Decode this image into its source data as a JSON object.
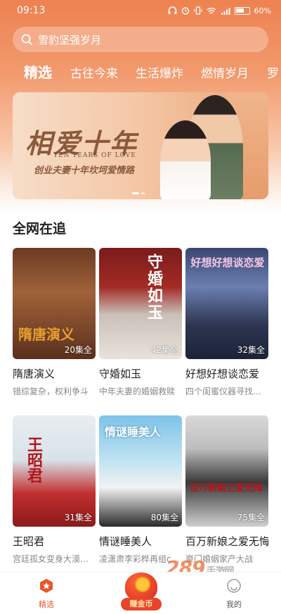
{
  "status_bar": {
    "time": "09:13",
    "battery": "60%"
  },
  "search": {
    "placeholder": "雪豹坚强岁月"
  },
  "tabs": [
    {
      "label": "精选",
      "active": true
    },
    {
      "label": "古往今来"
    },
    {
      "label": "生活爆炸"
    },
    {
      "label": "燃情岁月"
    },
    {
      "label": "罗"
    }
  ],
  "banner": {
    "title": "相爱十年",
    "subtitle_en": "TEN YEARS OF LOVE",
    "subtitle": "创业夫妻十年坎坷爱情路"
  },
  "section": {
    "title": "全网在追"
  },
  "cards": [
    {
      "name": "隋唐演义",
      "desc": "错综复杂，权利争斗",
      "episodes": "20集全",
      "poster_title": "隋唐演义"
    },
    {
      "name": "守婚如玉",
      "desc": "中年夫妻的婚姻救赎",
      "episodes": "42集全",
      "poster_title": "守婚如玉"
    },
    {
      "name": "好想好想谈恋爱",
      "desc": "四个闺蜜仪器寻找…",
      "episodes": "32集全",
      "poster_title": "好想好想谈恋爱"
    },
    {
      "name": "王昭君",
      "desc": "宫廷孤女变身大漠…",
      "episodes": "31集全",
      "poster_title": "王昭君"
    },
    {
      "name": "情谜睡美人",
      "desc": "凌潇肃李彩桦再组c…",
      "episodes": "80集全",
      "poster_title": "情谜睡美人"
    },
    {
      "name": "百万新娘之爱无悔",
      "desc": "豪门婚姻家产大战",
      "episodes": "75集全",
      "poster_title": "百万新娘之爱无悔"
    }
  ],
  "bottom_nav": {
    "home": "精选",
    "coins": "赚金币",
    "me": "我的"
  },
  "watermark": {
    "brand": "289",
    "suffix": "手游网"
  },
  "colors": {
    "accent": "#e8572b",
    "header": "#ee8250"
  }
}
